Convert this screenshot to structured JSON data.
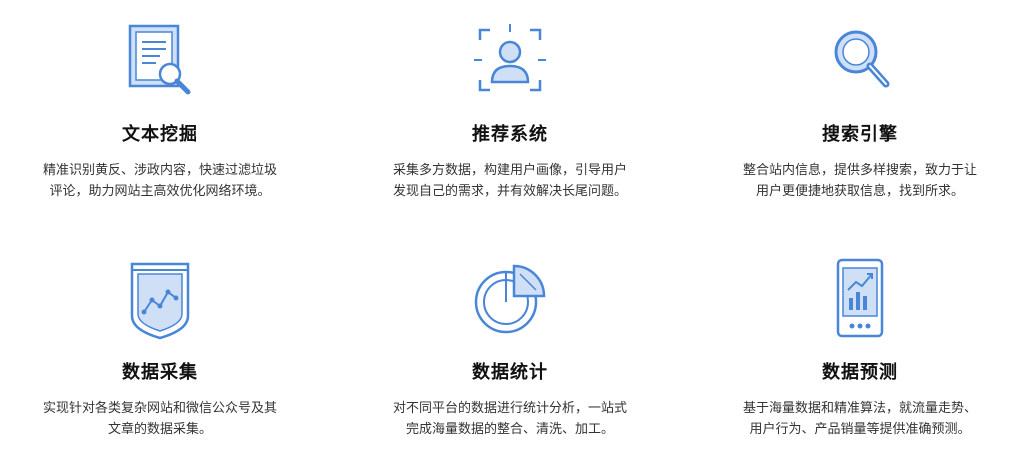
{
  "colors": {
    "icon_blue": "#4a86d8",
    "icon_light": "#cfe0f6"
  },
  "cards": [
    {
      "icon": "document-search-icon",
      "title": "文本挖掘",
      "desc_line1": "精准识别黄反、涉政内容，快速过滤垃圾",
      "desc_line2": "评论，助力网站主高效优化网络环境。"
    },
    {
      "icon": "user-portrait-icon",
      "title": "推荐系统",
      "desc_line1": "采集多方数据，构建用户画像，引导用户",
      "desc_line2": "发现自己的需求，并有效解决长尾问题。"
    },
    {
      "icon": "magnifier-icon",
      "title": "搜索引擎",
      "desc_line1": "整合站内信息，提供多样搜索，致力于让",
      "desc_line2": "用户更便捷地获取信息，找到所求。"
    },
    {
      "icon": "data-collection-icon",
      "title": "数据采集",
      "desc_line1": "实现针对各类复杂网站和微信公众号及其",
      "desc_line2": "文章的数据采集。"
    },
    {
      "icon": "pie-chart-icon",
      "title": "数据统计",
      "desc_line1": "对不同平台的数据进行统计分析，一站式",
      "desc_line2": "完成海量数据的整合、清洗、加工。"
    },
    {
      "icon": "mobile-trend-icon",
      "title": "数据预测",
      "desc_line1": "基于海量数据和精准算法，就流量走势、",
      "desc_line2": "用户行为、产品销量等提供准确预测。"
    }
  ]
}
